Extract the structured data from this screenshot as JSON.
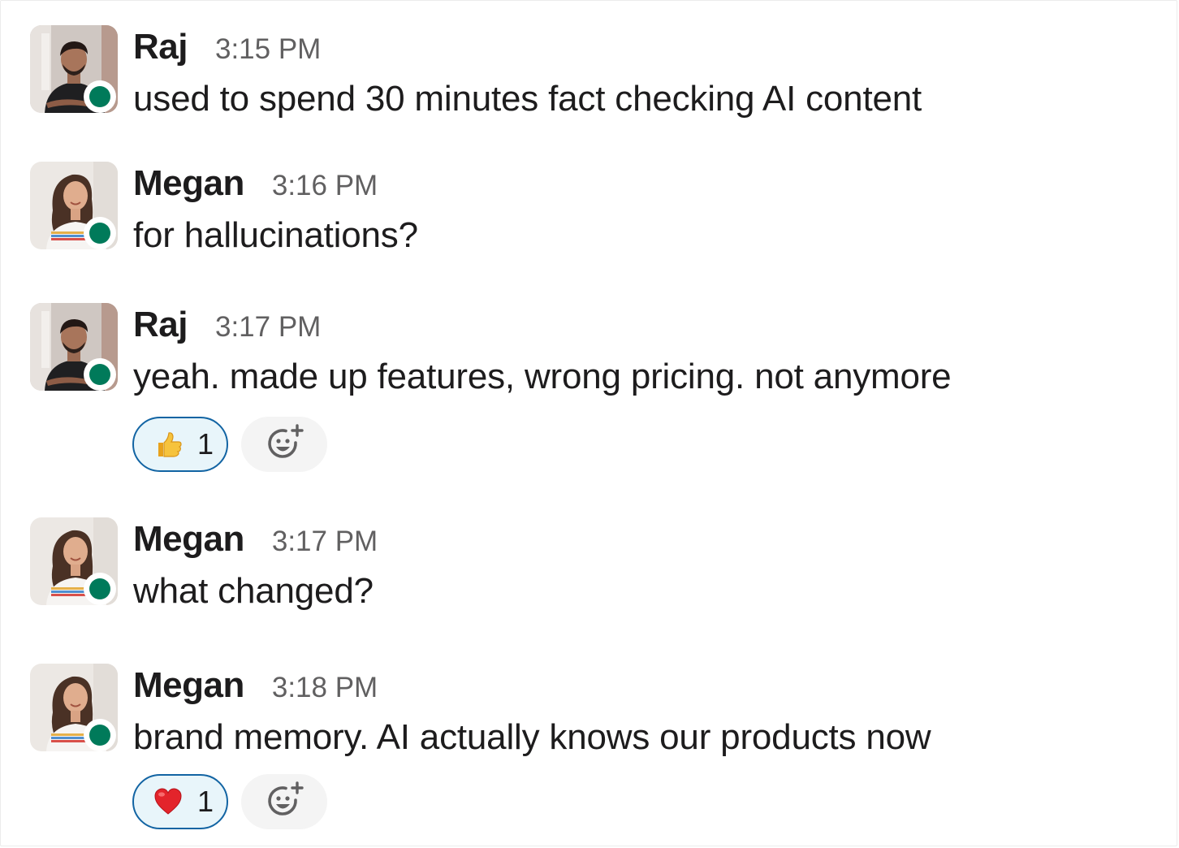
{
  "messages": [
    {
      "author": "Raj",
      "time": "3:15 PM",
      "text": "used to spend 30 minutes fact checking AI content",
      "avatar": "raj-avatar",
      "presence": "active"
    },
    {
      "author": "Megan",
      "time": "3:16 PM",
      "text": "for hallucinations?",
      "avatar": "megan-avatar",
      "presence": "active"
    },
    {
      "author": "Raj",
      "time": "3:17 PM",
      "text": "yeah. made up features, wrong pricing. not anymore",
      "avatar": "raj-avatar",
      "presence": "active",
      "reaction": {
        "emoji": "👍",
        "icon": "thumbs-up-icon",
        "count": "1"
      }
    },
    {
      "author": "Megan",
      "time": "3:17 PM",
      "text": "what changed?",
      "avatar": "megan-avatar",
      "presence": "active"
    },
    {
      "author": "Megan",
      "time": "3:18 PM",
      "text": "brand memory. AI actually knows our products now",
      "avatar": "megan-avatar",
      "presence": "active",
      "reaction": {
        "emoji": "❤️",
        "icon": "heart-icon",
        "count": "1"
      }
    }
  ],
  "colors": {
    "presence": "#007a5a",
    "reaction_border": "#1264a3",
    "reaction_bg": "#e8f5fa",
    "timestamp": "#616061",
    "text": "#1d1c1d"
  }
}
